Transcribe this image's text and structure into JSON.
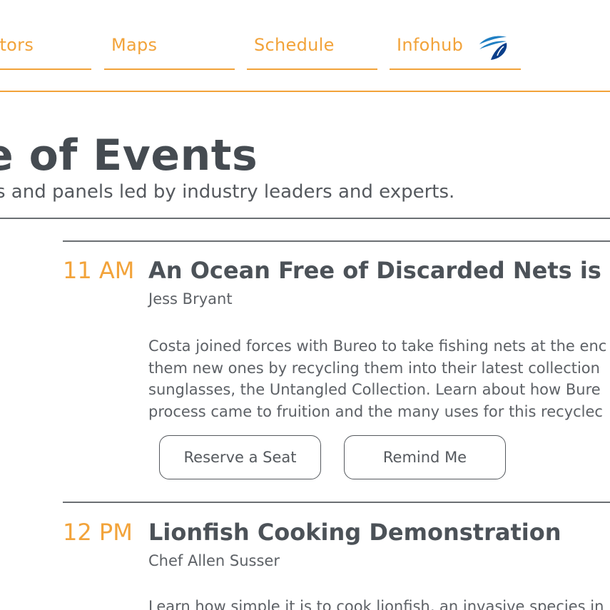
{
  "nav": {
    "items": [
      {
        "label": "ibitors"
      },
      {
        "label": "Maps"
      },
      {
        "label": "Schedule"
      },
      {
        "label": "Infohub"
      }
    ],
    "colors": {
      "accent": "#f2a33a",
      "logo_blue": "#1f7fc3",
      "logo_dark": "#0b3f8a"
    },
    "logo_icon": "fish-logo-icon"
  },
  "header": {
    "title": "e of Events",
    "subtitle": "s and panels led by industry leaders and experts."
  },
  "events": [
    {
      "time": "11 AM",
      "title": "An Ocean Free of Discarded Nets is a Si",
      "speaker": "Jess Bryant",
      "description_lines": [
        "Costa joined forces with Bureo to take fishing nets at the enc",
        "them new ones by recycling them into their latest collection",
        "sunglasses, the Untangled Collection. Learn about how Bure",
        "process came to fruition and the many uses for this recyclec"
      ],
      "buttons": {
        "reserve": "Reserve a Seat",
        "remind": "Remind Me"
      }
    },
    {
      "time": "12 PM",
      "title": "Lionfish Cooking Demonstration",
      "speaker": "Chef Allen Susser",
      "description_lines": [
        "Learn how simple it is to cook lionfish, an invasive species in"
      ]
    }
  ]
}
